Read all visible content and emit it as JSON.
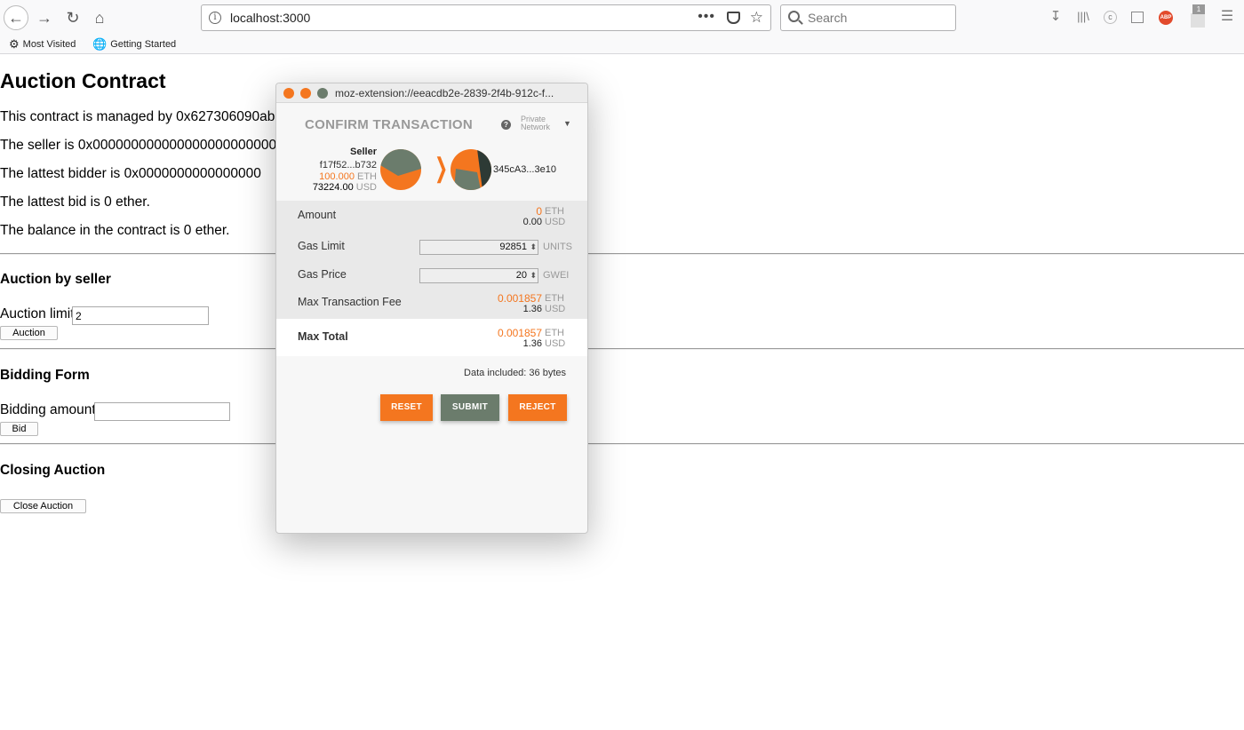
{
  "browser": {
    "url": "localhost:3000",
    "search_placeholder": "Search",
    "bookmarks": [
      "Most Visited",
      "Getting Started"
    ],
    "notification_count": "1",
    "abp_label": "ABP"
  },
  "page": {
    "title": "Auction Contract",
    "manager_line": "This contract is managed by 0x627306090ab",
    "seller_line": "The seller is 0x0000000000000000000000000",
    "bidder_line": "The lattest bidder is 0x0000000000000000",
    "bid_line": "The lattest bid is 0 ether.",
    "balance_line": "The balance in the contract is 0 ether.",
    "auction_section": {
      "heading": "Auction by seller",
      "label": "Auction limit",
      "value": "2",
      "button": "Auction"
    },
    "bidding_section": {
      "heading": "Bidding Form",
      "label": "Bidding amount",
      "value": "",
      "button": "Bid"
    },
    "closing_section": {
      "heading": "Closing Auction",
      "button": "Close Auction"
    }
  },
  "popup": {
    "window_url": "moz-extension://eeacdb2e-2839-2f4b-912c-f...",
    "title": "CONFIRM TRANSACTION",
    "network_line1": "Private",
    "network_line2": "Network",
    "seller": {
      "name": "Seller",
      "address": "f17f52...b732",
      "eth": "100.000",
      "eth_unit": "ETH",
      "usd": "73224.00",
      "usd_unit": "USD"
    },
    "recipient": "345cA3...3e10",
    "amount": {
      "label": "Amount",
      "eth": "0",
      "eth_unit": "ETH",
      "usd": "0.00",
      "usd_unit": "USD"
    },
    "gas_limit": {
      "label": "Gas Limit",
      "value": "92851",
      "unit": "UNITS"
    },
    "gas_price": {
      "label": "Gas Price",
      "value": "20",
      "unit": "GWEI"
    },
    "max_fee": {
      "label": "Max Transaction Fee",
      "eth": "0.001857",
      "eth_unit": "ETH",
      "usd": "1.36",
      "usd_unit": "USD"
    },
    "max_total": {
      "label": "Max Total",
      "eth": "0.001857",
      "eth_unit": "ETH",
      "usd": "1.36",
      "usd_unit": "USD"
    },
    "data_included": "Data included: 36 bytes",
    "buttons": {
      "reset": "RESET",
      "submit": "SUBMIT",
      "reject": "REJECT"
    }
  },
  "colors": {
    "metamask_orange": "#f4761f",
    "submit_green": "#6b7c6c",
    "identicon_green": "#6b7c6c"
  }
}
